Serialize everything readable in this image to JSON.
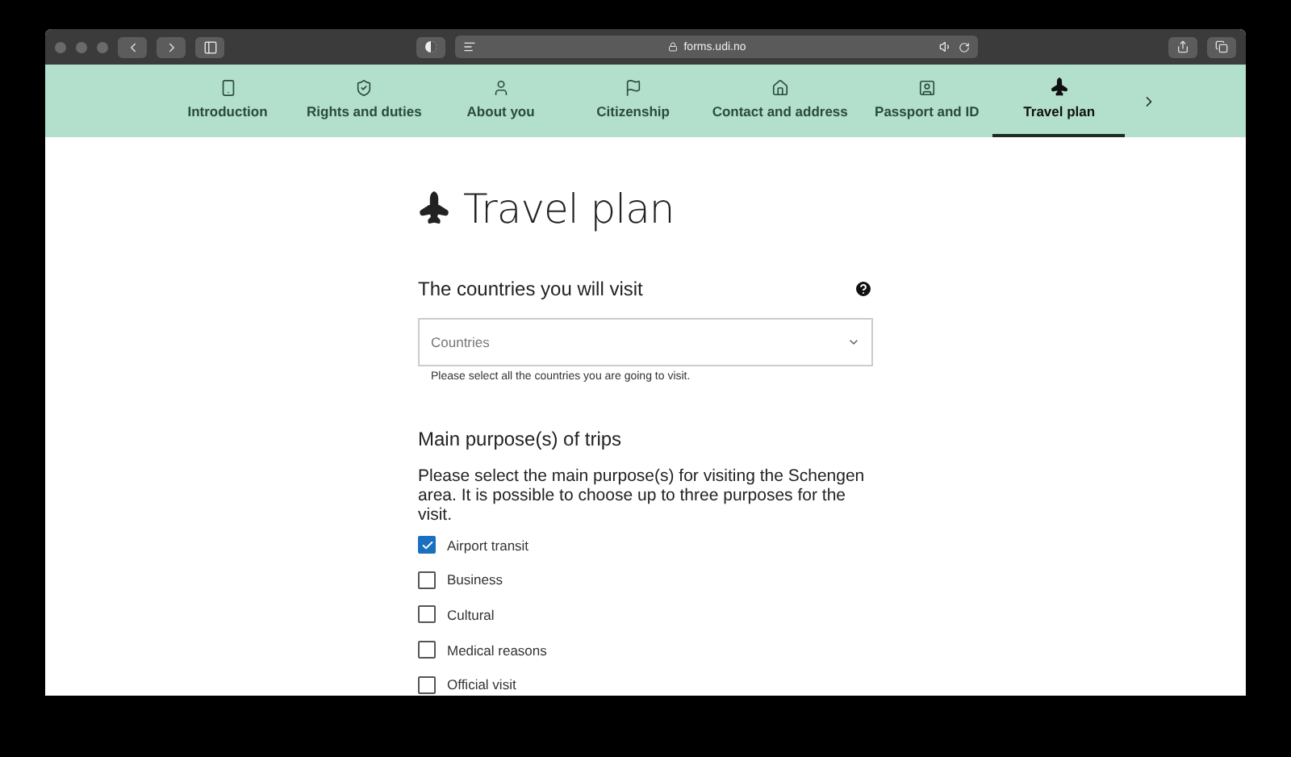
{
  "browser": {
    "url": "forms.udi.no"
  },
  "tabs": [
    {
      "label": "Introduction",
      "selected": false
    },
    {
      "label": "Rights and duties",
      "selected": false
    },
    {
      "label": "About you",
      "selected": false
    },
    {
      "label": "Citizenship",
      "selected": false
    },
    {
      "label": "Contact and address",
      "selected": false
    },
    {
      "label": "Passport and ID",
      "selected": false
    },
    {
      "label": "Travel plan",
      "selected": true
    }
  ],
  "page": {
    "title": "Travel plan"
  },
  "countries": {
    "label": "The countries you will visit",
    "placeholder": "Countries",
    "help": "Please select all the countries you are going to visit."
  },
  "purposes": {
    "heading": "Main purpose(s) of trips",
    "description": "Please select the main purpose(s) for visiting the Schengen area. It is possible to choose up to three purposes for the visit.",
    "options": [
      {
        "label": "Airport transit",
        "checked": true
      },
      {
        "label": "Business",
        "checked": false
      },
      {
        "label": "Cultural",
        "checked": false
      },
      {
        "label": "Medical reasons",
        "checked": false
      },
      {
        "label": "Official visit",
        "checked": false
      }
    ]
  }
}
